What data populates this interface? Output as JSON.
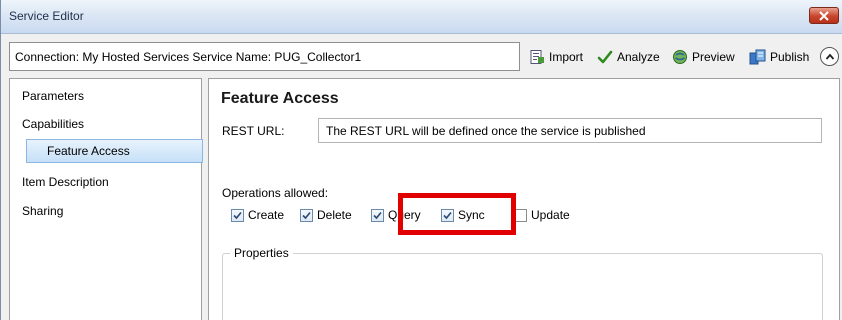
{
  "window": {
    "title": "Service Editor"
  },
  "toolbar": {
    "connection_text": "Connection: My Hosted Services   Service Name: PUG_Collector1",
    "import_label": "Import",
    "analyze_label": "Analyze",
    "preview_label": "Preview",
    "publish_label": "Publish"
  },
  "sidebar": {
    "items": [
      {
        "label": "Parameters",
        "selected": false
      },
      {
        "label": "Capabilities",
        "selected": false
      },
      {
        "label": "Feature Access",
        "selected": true
      },
      {
        "label": "Item Description",
        "selected": false
      },
      {
        "label": "Sharing",
        "selected": false
      }
    ]
  },
  "main": {
    "title": "Feature Access",
    "rest_url_label": "REST URL:",
    "rest_url_value": "The REST URL will be defined once the service is published",
    "operations_label": "Operations allowed:",
    "operations": [
      {
        "label": "Create",
        "checked": true
      },
      {
        "label": "Delete",
        "checked": true
      },
      {
        "label": "Query",
        "checked": true
      },
      {
        "label": "Sync",
        "checked": true
      },
      {
        "label": "Update",
        "checked": false
      }
    ],
    "properties_label": "Properties"
  },
  "colors": {
    "highlight": "#e00000",
    "selection": "#c6e0f8",
    "title_bar": "#dce7f4"
  }
}
